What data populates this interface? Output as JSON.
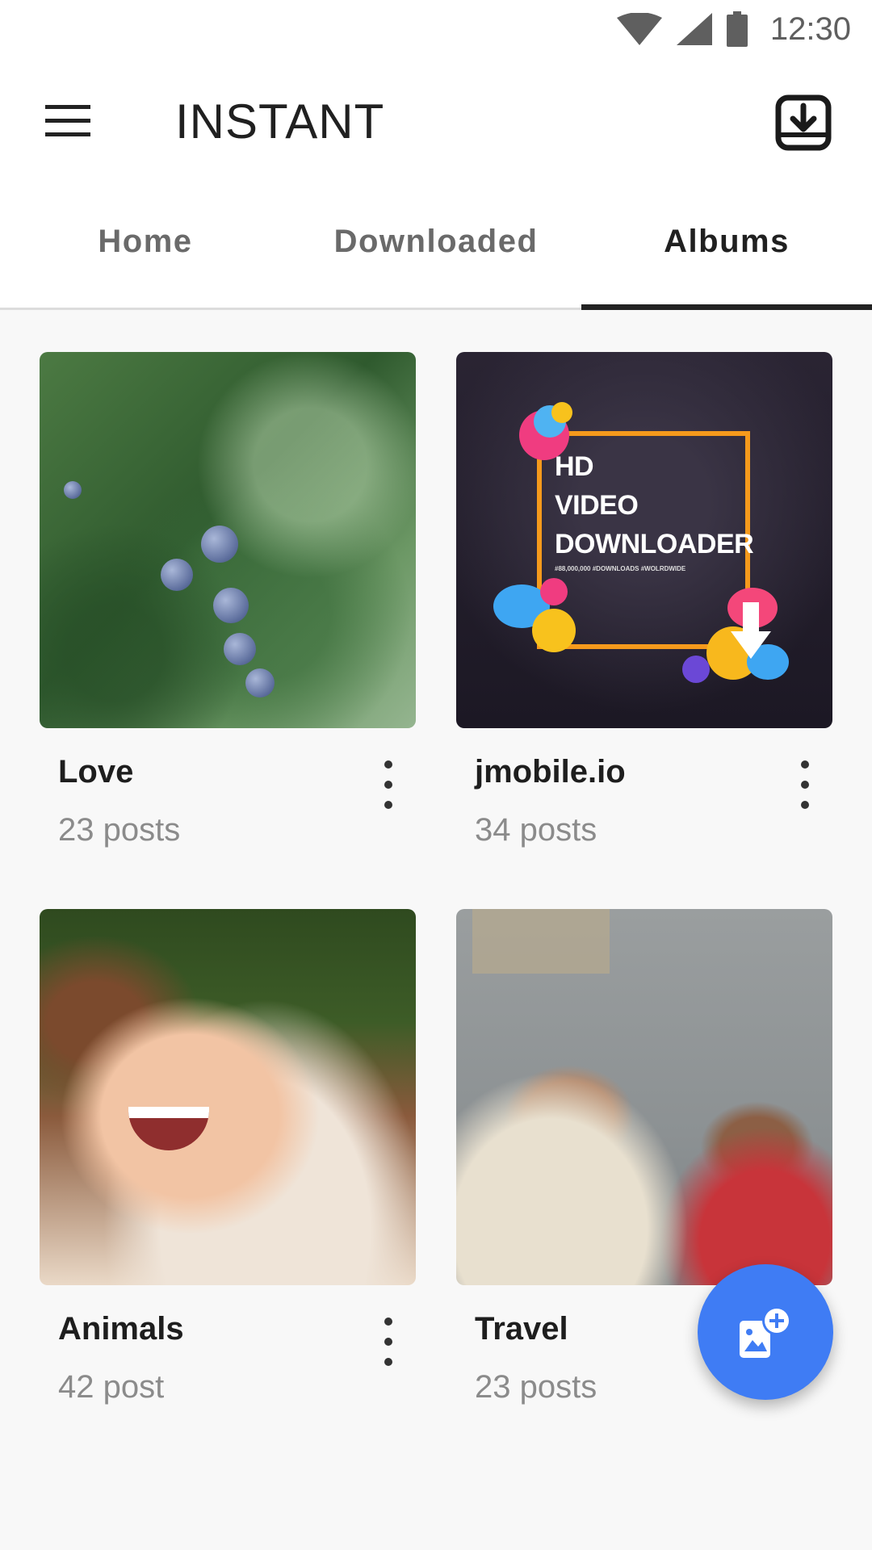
{
  "status_bar": {
    "time": "12:30",
    "icons": [
      "wifi-icon",
      "signal-icon",
      "battery-icon"
    ]
  },
  "app_bar": {
    "title": "INSTANT",
    "menu_icon": "menu-icon",
    "action_icon": "download-icon"
  },
  "tabs": [
    {
      "label": "Home",
      "active": false
    },
    {
      "label": "Downloaded",
      "active": false
    },
    {
      "label": "Albums",
      "active": true
    }
  ],
  "albums": [
    {
      "title": "Love",
      "count": "23 posts",
      "thumb": "juniper-branch-photo"
    },
    {
      "title": "jmobile.io",
      "count": "34 posts",
      "thumb": "hd-video-downloader-banner",
      "banner_lines": [
        "HD",
        "VIDEO",
        "DOWNLOADER"
      ],
      "banner_tagline": "#88,000,000 #DOWNLOADS #WOLRDWIDE"
    },
    {
      "title": "Animals",
      "count": "42 post",
      "thumb": "laughing-child-photo"
    },
    {
      "title": "Travel",
      "count": "23 posts",
      "thumb": "old-man-and-boy-photo"
    }
  ],
  "fab": {
    "icon": "add-photo-icon"
  },
  "colors": {
    "accent": "#3f7cf4",
    "tab_indicator": "#222222",
    "content_background": "#f8f8f8"
  }
}
